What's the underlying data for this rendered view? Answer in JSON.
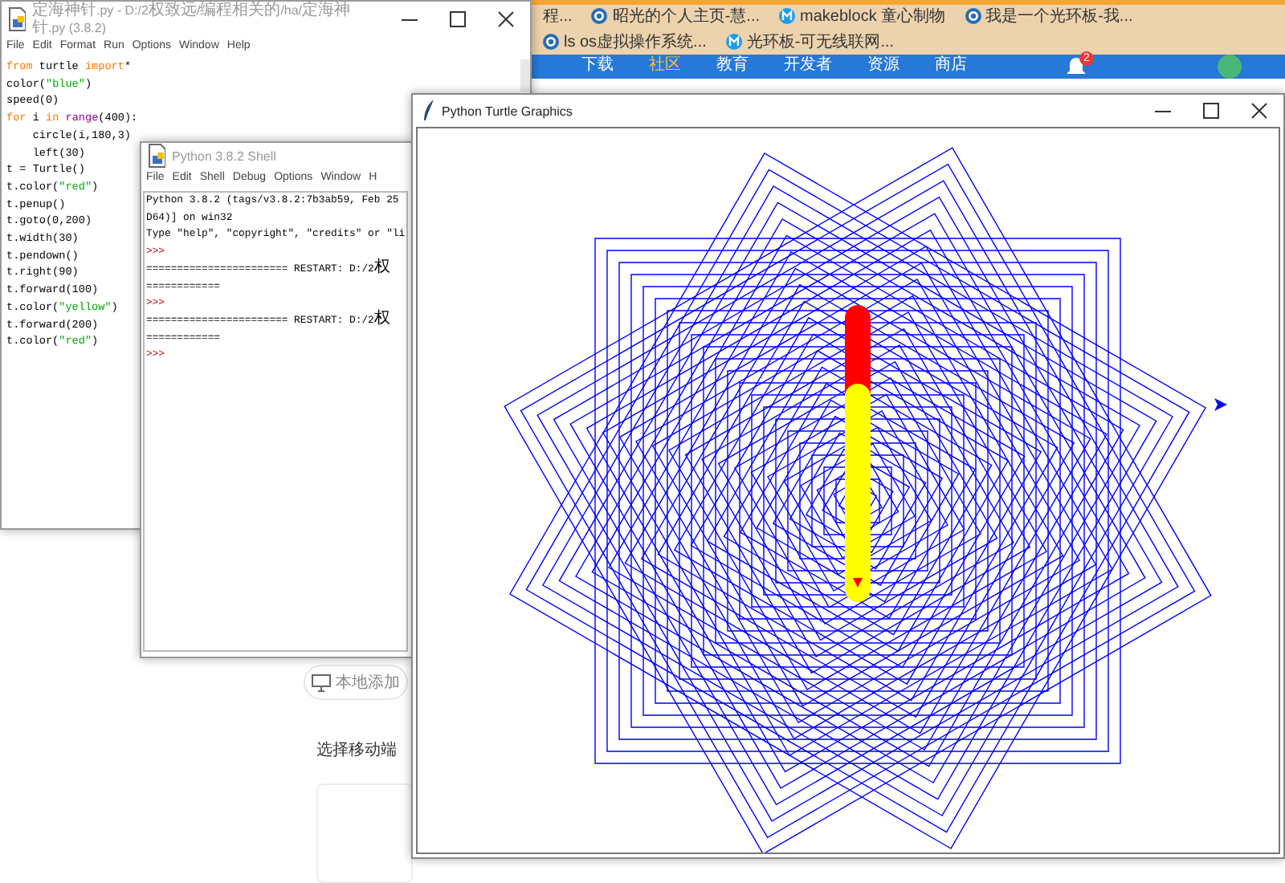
{
  "browser": {
    "bookmarks": [
      "程...",
      "昭光的个人主页-慧...",
      "makeblock 童心制物",
      "我是一个光环板-我...",
      "ls os虚拟操作系统...",
      "光环板-可无线联网..."
    ],
    "nav": [
      "下载",
      "社区",
      "教育",
      "开发者",
      "资源",
      "商店"
    ],
    "notification_badge": "2",
    "local_add_button": "本地添加",
    "section_title": "选择移动端"
  },
  "editor": {
    "title": "定海神针.py - D:/2权致远/编程相关的/ha/定海神针.py (3.8.2)",
    "menu": [
      "File",
      "Edit",
      "Format",
      "Run",
      "Options",
      "Window",
      "Help"
    ],
    "code": [
      [
        {
          "t": "from",
          "kind": "keyword"
        },
        {
          "t": " turtle ",
          "kind": "plain"
        },
        {
          "t": "import",
          "kind": "keyword"
        },
        {
          "t": "*",
          "kind": "plain"
        }
      ],
      [
        {
          "t": "color(",
          "kind": "plain"
        },
        {
          "t": "\"blue\"",
          "kind": "string"
        },
        {
          "t": ")",
          "kind": "plain"
        }
      ],
      [
        {
          "t": "speed(0)",
          "kind": "plain"
        }
      ],
      [
        {
          "t": "for",
          "kind": "keyword"
        },
        {
          "t": " i ",
          "kind": "plain"
        },
        {
          "t": "in ",
          "kind": "keyword"
        },
        {
          "t": "range",
          "kind": "builtin"
        },
        {
          "t": "(400):",
          "kind": "plain"
        }
      ],
      [
        {
          "t": "    circle(i,180,3)",
          "kind": "plain"
        }
      ],
      [
        {
          "t": "    left(30)",
          "kind": "plain"
        }
      ],
      [
        {
          "t": "t = Turtle()",
          "kind": "plain"
        }
      ],
      [
        {
          "t": "t.color(",
          "kind": "plain"
        },
        {
          "t": "\"red\"",
          "kind": "string"
        },
        {
          "t": ")",
          "kind": "plain"
        }
      ],
      [
        {
          "t": "t.penup()",
          "kind": "plain"
        }
      ],
      [
        {
          "t": "t.goto(0,200)",
          "kind": "plain"
        }
      ],
      [
        {
          "t": "t.width(30)",
          "kind": "plain"
        }
      ],
      [
        {
          "t": "t.pendown()",
          "kind": "plain"
        }
      ],
      [
        {
          "t": "t.right(90)",
          "kind": "plain"
        }
      ],
      [
        {
          "t": "t.forward(100)",
          "kind": "plain"
        }
      ],
      [
        {
          "t": "t.color(",
          "kind": "plain"
        },
        {
          "t": "\"yellow\"",
          "kind": "string"
        },
        {
          "t": ")",
          "kind": "plain"
        }
      ],
      [
        {
          "t": "t.forward(200)",
          "kind": "plain"
        }
      ],
      [
        {
          "t": "t.color(",
          "kind": "plain"
        },
        {
          "t": "\"red\"",
          "kind": "string"
        },
        {
          "t": ")",
          "kind": "plain"
        }
      ]
    ]
  },
  "shell": {
    "title": "Python 3.8.2 Shell",
    "menu": [
      "File",
      "Edit",
      "Shell",
      "Debug",
      "Options",
      "Window",
      "H"
    ],
    "lines": [
      {
        "text": "Python 3.8.2 (tags/v3.8.2:7b3ab59, Feb 25",
        "kind": "output"
      },
      {
        "text": "D64)] on win32",
        "kind": "output"
      },
      {
        "text": "Type \"help\", \"copyright\", \"credits\" or \"li",
        "kind": "output"
      },
      {
        "text": ">>>",
        "kind": "prompt"
      },
      {
        "text": "======================= RESTART: D:/2权",
        "kind": "output"
      },
      {
        "text": "============",
        "kind": "output"
      },
      {
        "text": ">>>",
        "kind": "prompt"
      },
      {
        "text": "======================= RESTART: D:/2权",
        "kind": "output"
      },
      {
        "text": "============",
        "kind": "output"
      },
      {
        "text": ">>>",
        "kind": "prompt"
      }
    ]
  },
  "turtle": {
    "title": "Python Turtle Graphics"
  }
}
